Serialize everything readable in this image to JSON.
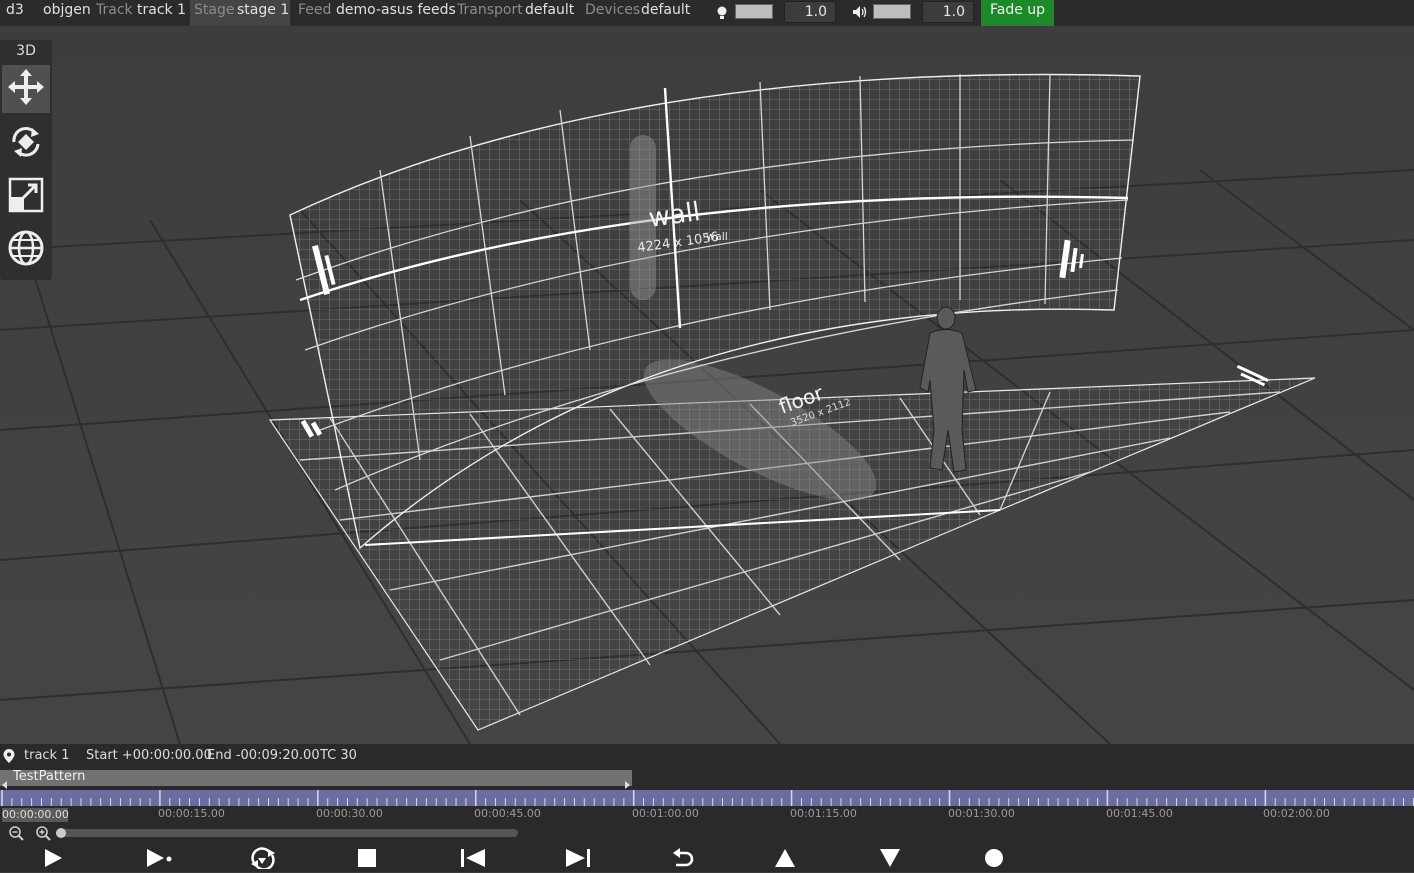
{
  "topbar": {
    "app": "d3",
    "project": "objgen",
    "track_label": "Track",
    "track_value": "track 1",
    "stage_label": "Stage",
    "stage_value": "stage 1",
    "feed_label": "Feed",
    "feed_value": "demo-asus feeds",
    "transport_label": "Transport",
    "transport_value": "default",
    "devices_label": "Devices",
    "devices_value": "default",
    "brightness_value": "1.0",
    "volume_value": "1.0",
    "fade_button": "Fade up",
    "fade_color": "#1d8a2a"
  },
  "tools": {
    "label": "3D",
    "items": [
      "move-icon",
      "rotate-icon",
      "scale-icon",
      "globe-icon"
    ],
    "selected": "move-icon"
  },
  "viewport": {
    "wall_label": "wall",
    "wall_res": "4224 x 1056",
    "wall_label_small": "wall",
    "floor_label": "floor",
    "floor_res": "3520 x 2112"
  },
  "timeline": {
    "track_name": "track 1",
    "start": "Start +00:00:00.00",
    "end": "End -00:09:20.00",
    "tc": "TC 30",
    "clip_name": "TestPattern",
    "current_time": "00:00:00.00",
    "ticks": [
      "00:00:15.00",
      "00:00:30.00",
      "00:00:45.00",
      "00:01:00.00",
      "00:01:15.00",
      "00:01:30.00",
      "00:01:45.00",
      "00:02:00.00"
    ],
    "ruler_color": "#6c6ca0"
  },
  "transport": [
    "play-icon",
    "play-to-end-icon",
    "loop-icon",
    "stop-icon",
    "previous-section-icon",
    "next-section-icon",
    "return-icon",
    "up-icon",
    "down-icon",
    "record-icon"
  ]
}
